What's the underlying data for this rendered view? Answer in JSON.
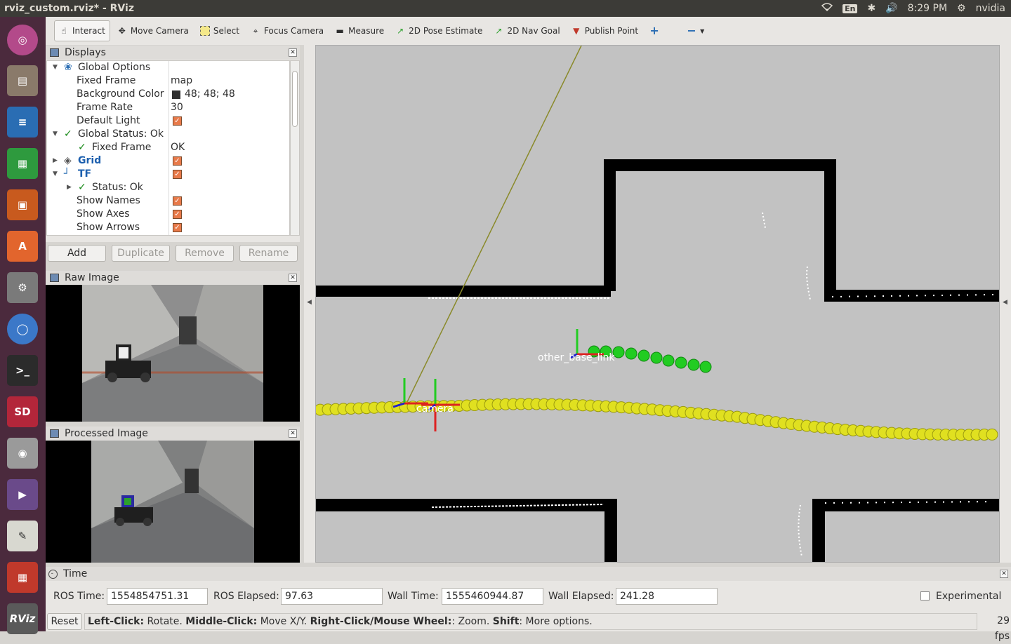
{
  "window": {
    "title": "rviz_custom.rviz* - RViz"
  },
  "topbar": {
    "keyboard": "En",
    "clock": "8:29 PM",
    "user": "nvidia"
  },
  "toolbar": {
    "interact": "Interact",
    "move_camera": "Move Camera",
    "select": "Select",
    "focus_camera": "Focus Camera",
    "measure": "Measure",
    "pose_estimate": "2D Pose Estimate",
    "nav_goal": "2D Nav Goal",
    "publish_point": "Publish Point"
  },
  "displays": {
    "title": "Displays",
    "rows": {
      "global_options": "Global Options",
      "fixed_frame": "Fixed Frame",
      "fixed_frame_val": "map",
      "bg_color": "Background Color",
      "bg_color_val": "48; 48; 48",
      "frame_rate": "Frame Rate",
      "frame_rate_val": "30",
      "default_light": "Default Light",
      "global_status": "Global Status: Ok",
      "fixed_frame_status": "Fixed Frame",
      "fixed_frame_status_val": "OK",
      "grid": "Grid",
      "tf": "TF",
      "tf_status": "Status: Ok",
      "show_names": "Show Names",
      "show_axes": "Show Axes",
      "show_arrows": "Show Arrows"
    },
    "buttons": {
      "add": "Add",
      "duplicate": "Duplicate",
      "remove": "Remove",
      "rename": "Rename"
    }
  },
  "raw_image": {
    "title": "Raw Image"
  },
  "processed_image": {
    "title": "Processed Image"
  },
  "viewport": {
    "label_other": "other_base_link",
    "label_camera": "camera"
  },
  "time": {
    "title": "Time",
    "ros_time_label": "ROS Time:",
    "ros_time": "1554854751.31",
    "ros_elapsed_label": "ROS Elapsed:",
    "ros_elapsed": "97.63",
    "wall_time_label": "Wall Time:",
    "wall_time": "1555460944.87",
    "wall_elapsed_label": "Wall Elapsed:",
    "wall_elapsed": "241.28",
    "experimental": "Experimental"
  },
  "statusbar": {
    "reset": "Reset",
    "left_click_b": "Left-Click:",
    "left_click": " Rotate. ",
    "middle_click_b": "Middle-Click:",
    "middle_click": " Move X/Y. ",
    "right_click_b": "Right-Click/Mouse Wheel:",
    "right_click": ": Zoom. ",
    "shift_b": "Shift",
    "shift": ": More options.",
    "fps": "29 fps"
  }
}
